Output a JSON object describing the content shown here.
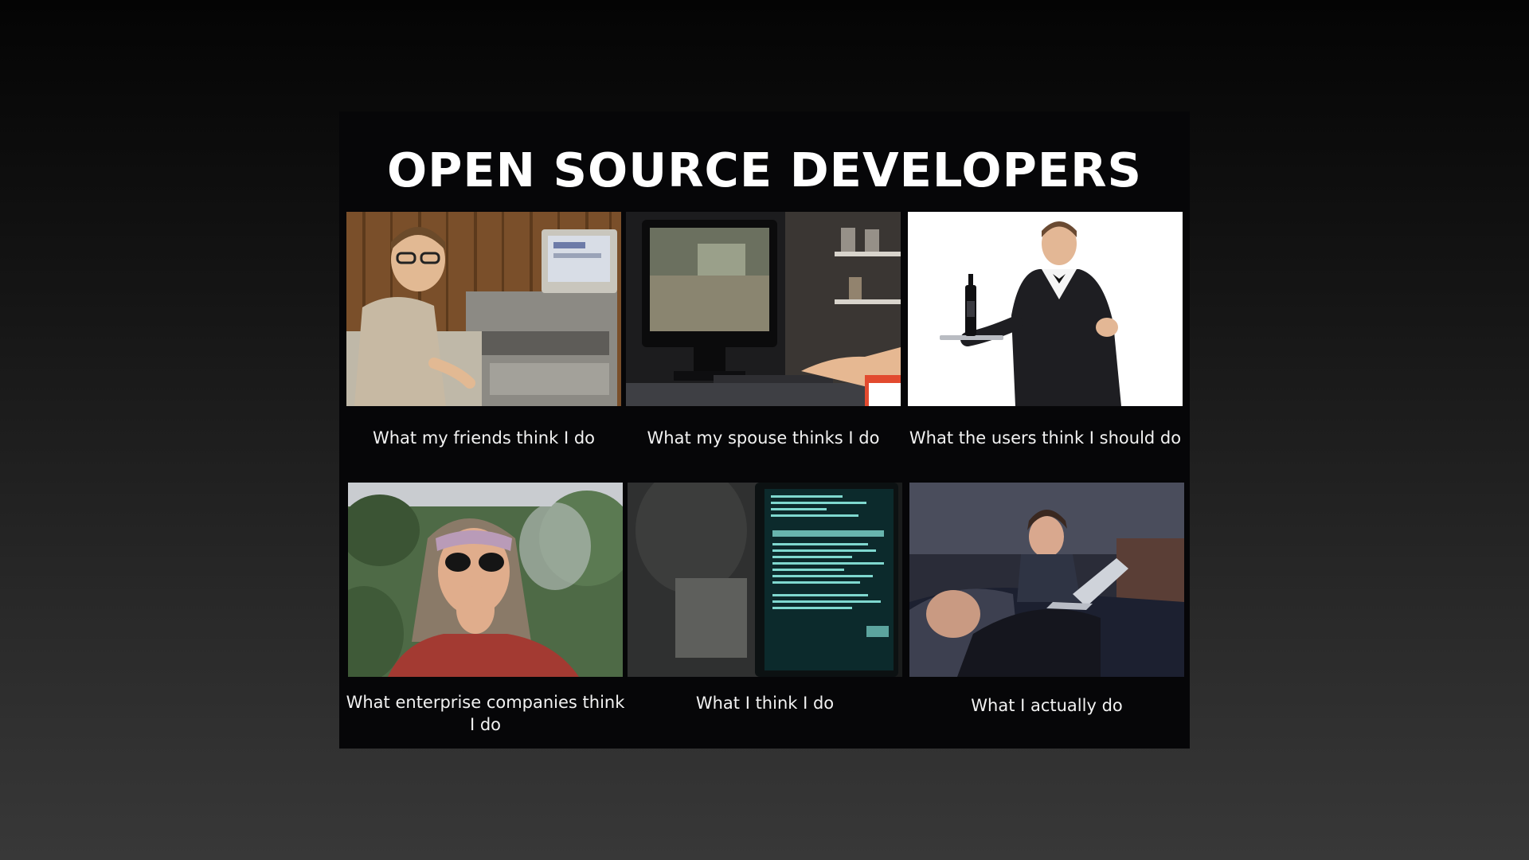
{
  "meme": {
    "title": "OPEN SOURCE DEVELOPERS",
    "panels": [
      {
        "caption": "What my friends think I do",
        "photo": "nerd-at-old-computer"
      },
      {
        "caption": "What my spouse thinks I do",
        "photo": "gaming-pc-screen"
      },
      {
        "caption": "What the users think I should do",
        "photo": "waiter-serving-wine"
      },
      {
        "caption": "What enterprise companies think I do",
        "photo": "hippie-smoking"
      },
      {
        "caption": "What I think I do",
        "photo": "hacker-terminal"
      },
      {
        "caption": "What I actually do",
        "photo": "laptop-in-bed-at-night"
      }
    ]
  },
  "colors": {
    "background_top": "#040404",
    "background_bottom": "#383838",
    "meme_background": "#060608",
    "text": "#ffffff"
  }
}
